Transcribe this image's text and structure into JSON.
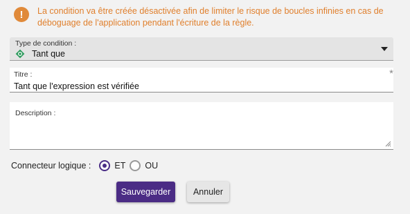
{
  "warning": {
    "icon": "warning-icon",
    "text": "La condition va être créée désactivée afin de limiter le risque de boucles infinies en cas de déboguage de l'application pendant l'écriture de la règle."
  },
  "condition_type": {
    "label": "Type de condition :",
    "value": "Tant que",
    "icon": "loop-diamond-icon"
  },
  "title_field": {
    "label": "Titre :",
    "value": "Tant que l'expression est vérifiée",
    "required_mark": "*"
  },
  "description_field": {
    "label": "Description :",
    "value": ""
  },
  "connector": {
    "label": "Connecteur logique :",
    "options": [
      {
        "label": "ET",
        "selected": true
      },
      {
        "label": "OU",
        "selected": false
      }
    ]
  },
  "buttons": {
    "save": "Sauvegarder",
    "cancel": "Annuler"
  },
  "colors": {
    "accent": "#4b2c85",
    "warning": "#e07f2c",
    "loop_icon": "#2e9b5e"
  }
}
